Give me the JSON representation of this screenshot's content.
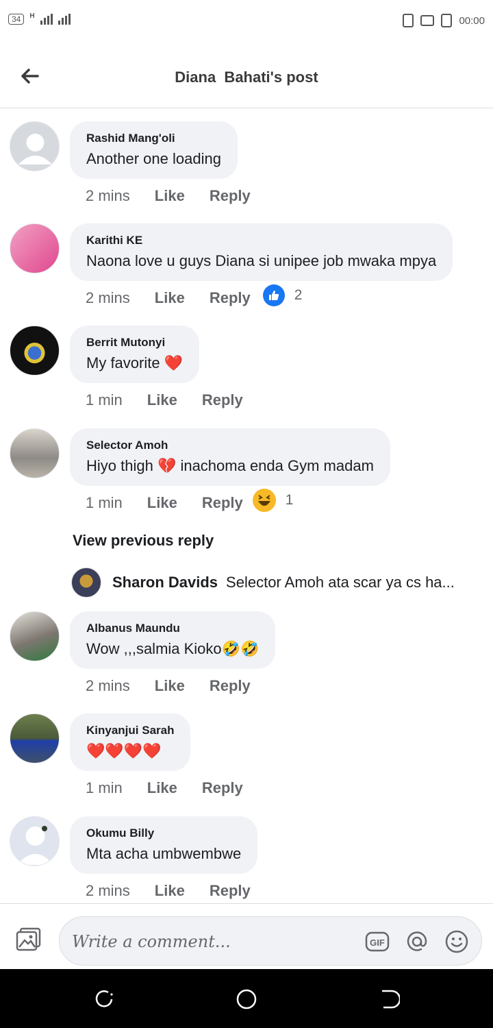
{
  "status_bar": {
    "badge": "34",
    "signal": "H",
    "time": "00:00"
  },
  "header": {
    "title": "Diana  Bahati's post"
  },
  "comments": [
    {
      "name": "Rashid Mang'oli",
      "text": "Another one loading",
      "time": "2 mins",
      "like": "Like",
      "reply": "Reply"
    },
    {
      "name": "Karithi KE",
      "text": "Naona love u guys Diana si unipee job mwaka mpya",
      "time": "2 mins",
      "like": "Like",
      "reply": "Reply",
      "reaction_icon": "like-reaction-icon",
      "reaction_count": "2"
    },
    {
      "name": "Berrit Mutonyi",
      "text": "My favorite ❤️",
      "time": "1 min",
      "like": "Like",
      "reply": "Reply"
    },
    {
      "name": "Selector Amoh",
      "text": "Hiyo thigh 💔 inachoma enda Gym madam",
      "time": "1 min",
      "like": "Like",
      "reply": "Reply",
      "reaction_icon": "haha-reaction-icon",
      "reaction_count": "1"
    },
    {
      "name": "Albanus Maundu",
      "text": "Wow ,,,salmia Kioko🤣🤣",
      "time": "2 mins",
      "like": "Like",
      "reply": "Reply"
    },
    {
      "name": "Kinyanjui Sarah",
      "text": "❤️❤️❤️❤️",
      "time": "1 min",
      "like": "Like",
      "reply": "Reply"
    },
    {
      "name": "Okumu Billy",
      "text": "Mta acha umbwembwe",
      "time": "2 mins",
      "like": "Like",
      "reply": "Reply"
    }
  ],
  "view_previous": "View previous reply",
  "reply_preview": {
    "name": "Sharon Davids",
    "text": "Selector Amoh ata scar ya cs ha..."
  },
  "composer": {
    "placeholder": "Write a comment...",
    "icons": [
      "photo-icon",
      "gif-icon",
      "mention-icon",
      "emoji-icon"
    ]
  },
  "colors": {
    "accent": "#1877f2",
    "bubble": "#f0f2f5",
    "meta": "#65676b"
  }
}
